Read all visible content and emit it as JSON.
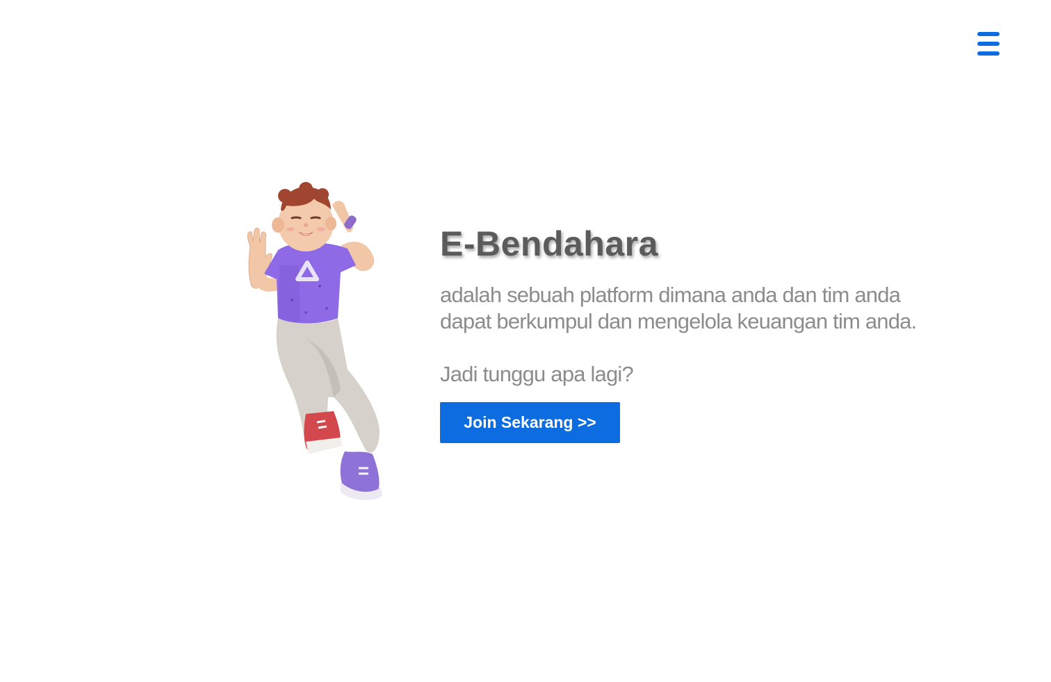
{
  "navbar": {
    "menu_icon": "hamburger-menu-icon",
    "menu_color": "#0d6de0"
  },
  "hero": {
    "illustration": "person-3d-character-illustration",
    "title": "E-Bendahara",
    "description": "adalah sebuah platform dimana anda dan tim anda dapat berkumpul dan mengelola keuangan tim anda.",
    "question": "Jadi tunggu apa lagi?",
    "cta_label": "Join Sekarang >>",
    "cta_color": "#0d6de0"
  }
}
